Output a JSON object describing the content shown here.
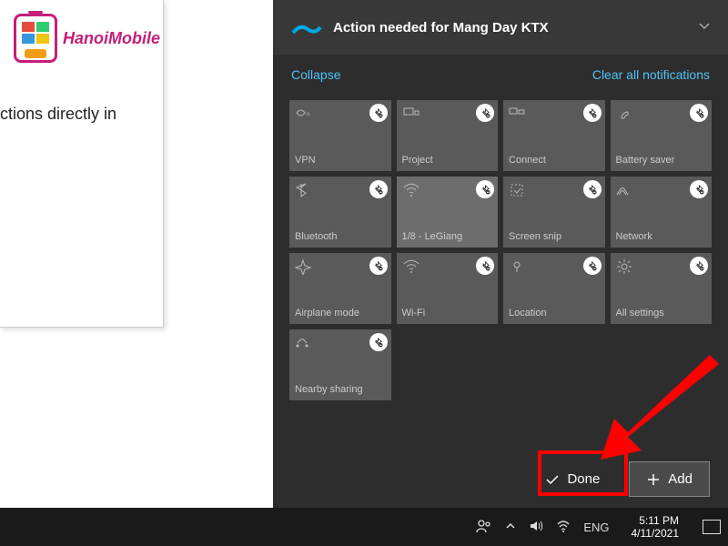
{
  "logo": {
    "text": "HanoiMobile"
  },
  "left_text": "ctions directly in",
  "notification": {
    "title": "Action needed for Mang Day KTX"
  },
  "links": {
    "collapse": "Collapse",
    "clear": "Clear all notifications"
  },
  "tiles": [
    {
      "label": "VPN",
      "icon": "vpn"
    },
    {
      "label": "Project",
      "icon": "project"
    },
    {
      "label": "Connect",
      "icon": "connect"
    },
    {
      "label": "Battery saver",
      "icon": "battery"
    },
    {
      "label": "Bluetooth",
      "icon": "bluetooth"
    },
    {
      "label": "1/8 - LeGiang",
      "icon": "wifi",
      "bright": true
    },
    {
      "label": "Screen snip",
      "icon": "snip"
    },
    {
      "label": "Network",
      "icon": "network"
    },
    {
      "label": "Airplane mode",
      "icon": "airplane"
    },
    {
      "label": "Wi-Fi",
      "icon": "wifi"
    },
    {
      "label": "Location",
      "icon": "location"
    },
    {
      "label": "All settings",
      "icon": "settings"
    },
    {
      "label": "Nearby sharing",
      "icon": "share"
    }
  ],
  "buttons": {
    "done": "Done",
    "add": "Add"
  },
  "taskbar": {
    "lang": "ENG",
    "time": "5:11 PM",
    "date": "4/11/2021"
  }
}
